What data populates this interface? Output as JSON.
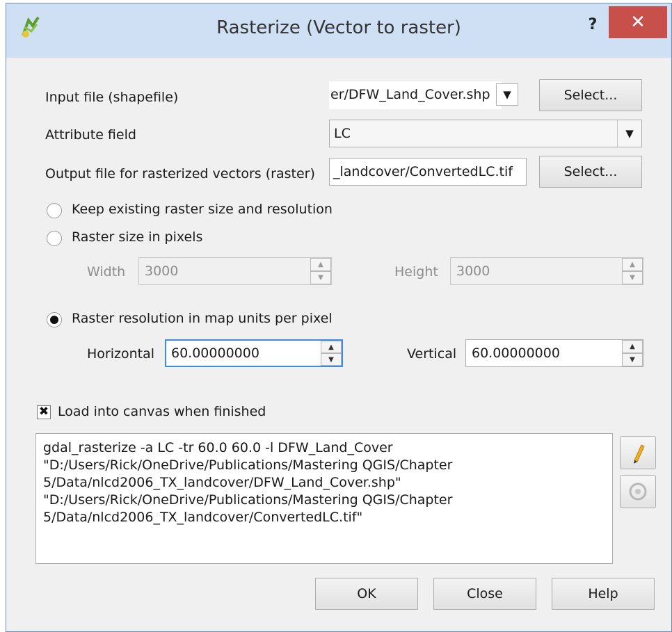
{
  "window": {
    "title": "Rasterize (Vector to raster)",
    "help_label": "?",
    "close_label": "✕",
    "close_color": "#c8504a"
  },
  "form": {
    "input_file": {
      "label": "Input file (shapefile)",
      "value": "er/DFW_Land_Cover.shp",
      "select_label": "Select..."
    },
    "attribute_field": {
      "label": "Attribute field",
      "value": "LC"
    },
    "output_file": {
      "label": "Output file for rasterized vectors (raster)",
      "value": "_landcover/ConvertedLC.tif",
      "select_label": "Select..."
    },
    "options": {
      "keep_existing": {
        "label": "Keep existing raster size and resolution",
        "selected": false
      },
      "raster_size": {
        "label": "Raster size in pixels",
        "selected": false,
        "width_label": "Width",
        "width_value": "3000",
        "height_label": "Height",
        "height_value": "3000"
      },
      "raster_resolution": {
        "label": "Raster resolution in map units per pixel",
        "selected": true,
        "horizontal_label": "Horizontal",
        "horizontal_value": "60.00000000",
        "vertical_label": "Vertical",
        "vertical_value": "60.00000000"
      }
    },
    "load_into_canvas": {
      "label": "Load into canvas when finished",
      "checked": true
    }
  },
  "command_text": "gdal_rasterize -a LC -tr 60.0 60.0 -l DFW_Land_Cover \"D:/Users/Rick/OneDrive/Publications/Mastering QGIS/Chapter 5/Data/nlcd2006_TX_landcover/DFW_Land_Cover.shp\" \"D:/Users/Rick/OneDrive/Publications/Mastering QGIS/Chapter 5/Data/nlcd2006_TX_landcover/ConvertedLC.tif\"",
  "tool_icons": {
    "edit": "pencil-icon",
    "reset": "reset-icon"
  },
  "buttons": {
    "ok": "OK",
    "close": "Close",
    "help": "Help"
  }
}
